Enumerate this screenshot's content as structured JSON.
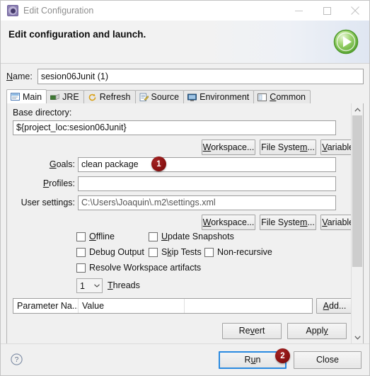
{
  "window": {
    "title": "Edit Configuration",
    "icon": "launch-config-icon",
    "minimize_label": "Minimize",
    "maximize_label": "Maximize",
    "close_label": "Close"
  },
  "banner": {
    "title": "Edit configuration and launch.",
    "icon": "run-green-play-icon"
  },
  "name": {
    "label": "Name:",
    "value": "sesion06Junit (1)"
  },
  "tabs": [
    {
      "label": "Main",
      "icon": "main-tab-icon",
      "active": true
    },
    {
      "label": "JRE",
      "icon": "jre-tab-icon",
      "active": false
    },
    {
      "label": "Refresh",
      "icon": "refresh-tab-icon",
      "active": false
    },
    {
      "label": "Source",
      "icon": "source-tab-icon",
      "active": false
    },
    {
      "label": "Environment",
      "icon": "environment-tab-icon",
      "active": false
    },
    {
      "label": "Common",
      "icon": "common-tab-icon",
      "active": false
    }
  ],
  "main": {
    "base_directory_label": "Base directory:",
    "base_directory_value": "${project_loc:sesion06Junit}",
    "goals_label": "Goals:",
    "goals_value": "clean package",
    "profiles_label": "Profiles:",
    "profiles_value": "",
    "user_settings_label": "User settings:",
    "user_settings_value": "C:\\Users\\Joaquin\\.m2\\settings.xml",
    "browse_buttons": [
      "Workspace...",
      "File System...",
      "Variables..."
    ],
    "checkboxes": [
      {
        "label": "Offline",
        "checked": false
      },
      {
        "label": "Update Snapshots",
        "checked": false
      },
      {
        "label": "Debug Output",
        "checked": false
      },
      {
        "label": "Skip Tests",
        "checked": false
      },
      {
        "label": "Non-recursive",
        "checked": false
      },
      {
        "label": "Resolve Workspace artifacts",
        "checked": false
      }
    ],
    "threads_value": "1",
    "threads_label": "Threads",
    "table_headers": [
      "Parameter Na...",
      "Value"
    ],
    "add_button": "Add...",
    "revert_button": "Revert",
    "apply_button": "Apply"
  },
  "footer": {
    "help_icon": "help-question-icon",
    "run_button": "Run",
    "close_button": "Close"
  },
  "annotations": [
    {
      "number": "1",
      "target": "goals-field"
    },
    {
      "number": "2",
      "target": "run-button"
    }
  ],
  "colors": {
    "badge": "#8d1313",
    "focus_border": "#2a8ae0",
    "accent_green": "#6abf4b"
  }
}
